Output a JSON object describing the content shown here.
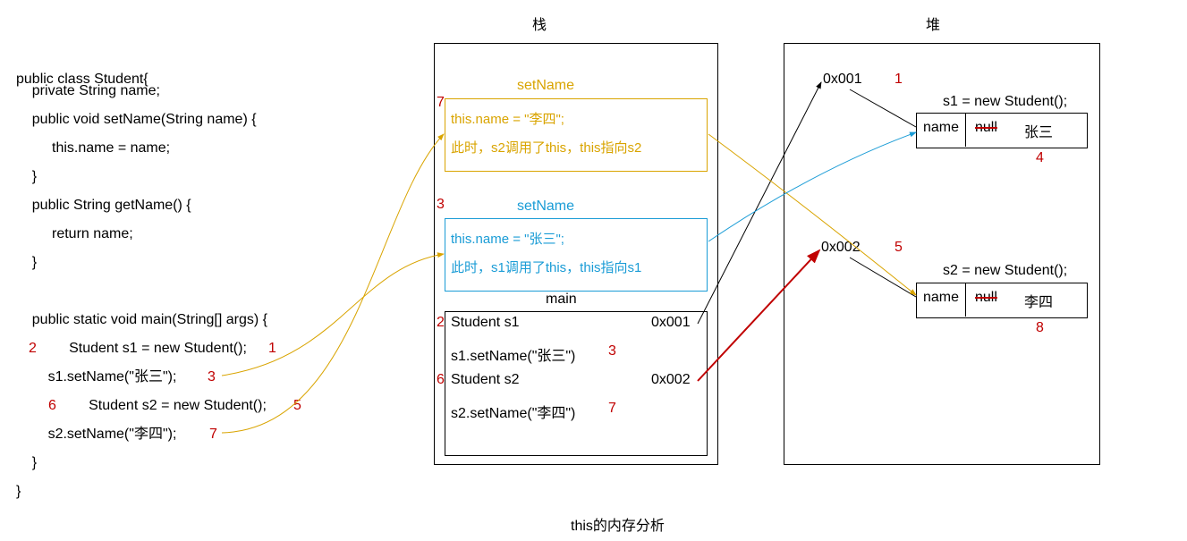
{
  "headings": {
    "stack": "栈",
    "heap": "堆",
    "caption": "this的内存分析"
  },
  "code": {
    "l1": "public class Student{",
    "l2": "    private String name;",
    "l3": "    public void setName(String name) {",
    "l4": "         this.name = name;",
    "l5": "    }",
    "l6": "    public String getName() {",
    "l7": "         return name;",
    "l8": "    }",
    "l9": "",
    "l10": "    public static void main(String[] args) {",
    "l11a": "       Student s1 = new Student();",
    "l12": "        s1.setName(\"张三\");",
    "l13a": "       Student s2 = new Student();",
    "l14": "        s2.setName(\"李四\");",
    "l15": "    }",
    "l16": "}"
  },
  "code_markers": {
    "m2": "2",
    "m1": "1",
    "m3": "3",
    "m6": "6",
    "m5": "5",
    "m7": "7"
  },
  "stack": {
    "setNameTop": {
      "title": "setName",
      "line1": "this.name = \"李四\";",
      "line2": "此时，s2调用了this，this指向s2",
      "marker": "7"
    },
    "setNameMid": {
      "title": "setName",
      "line1": "this.name = \"张三\";",
      "line2": "此时，s1调用了this，this指向s1",
      "marker": "3"
    },
    "main": {
      "title": "main",
      "row1_left": "Student s1",
      "row1_right": "0x001",
      "row1_marker": "2",
      "row2": "s1.setName(\"张三\")",
      "row2_marker": "3",
      "row3_left": "Student s2",
      "row3_right": "0x002",
      "row3_marker": "6",
      "row4": "s2.setName(\"李四\")",
      "row4_marker": "7"
    }
  },
  "heap": {
    "addr1": "0x001",
    "addr1_marker": "1",
    "obj1_label": "s1 = new Student();",
    "obj1_field": "name",
    "obj1_val_old": "null",
    "obj1_val_new": "张三",
    "obj1_new_marker": "4",
    "addr2": "0x002",
    "addr2_marker": "5",
    "obj2_label": "s2 = new Student();",
    "obj2_field": "name",
    "obj2_val_old": "null",
    "obj2_val_new": "李四",
    "obj2_new_marker": "8"
  }
}
